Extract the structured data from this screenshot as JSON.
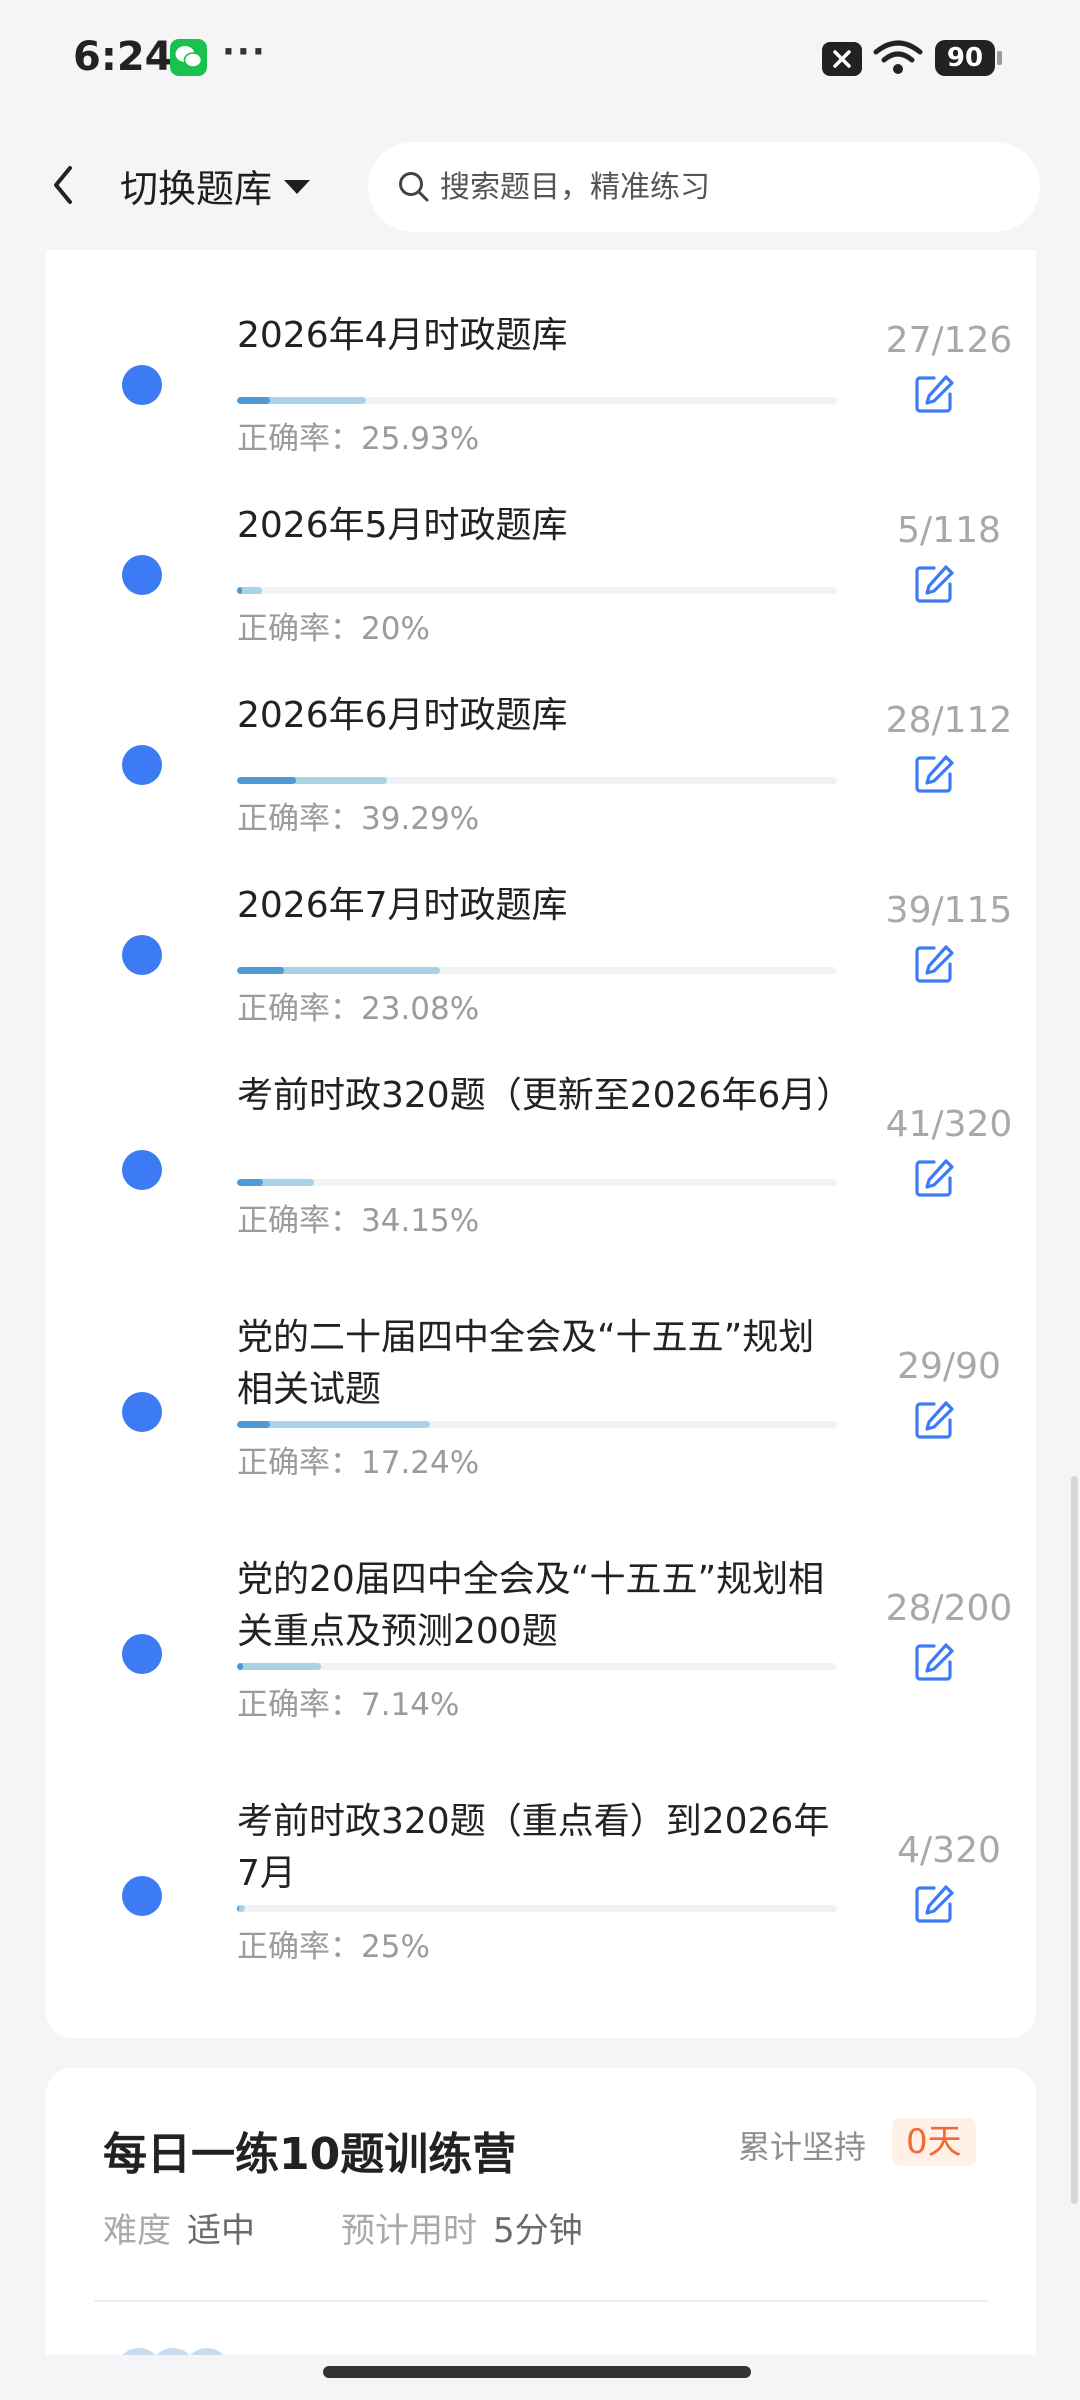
{
  "status_bar": {
    "time": "6:24",
    "more": "···",
    "battery": "90",
    "icons": [
      "wechat-icon",
      "sim-off-icon",
      "wifi-icon",
      "battery-icon"
    ]
  },
  "header": {
    "back_icon": "chevron-left-icon",
    "switch_label": "切换题库",
    "search_placeholder": "搜索题目，精准练习"
  },
  "banks": [
    {
      "title": "2026年4月时政题库",
      "accuracy": "正确率：25.93%",
      "count": "27/126",
      "done": 27,
      "total": 126,
      "rate": 25.93
    },
    {
      "title": "2026年5月时政题库",
      "accuracy": "正确率：20%",
      "count": "5/118",
      "done": 5,
      "total": 118,
      "rate": 20
    },
    {
      "title": "2026年6月时政题库",
      "accuracy": "正确率：39.29%",
      "count": "28/112",
      "done": 28,
      "total": 112,
      "rate": 39.29
    },
    {
      "title": "2026年7月时政题库",
      "accuracy": "正确率：23.08%",
      "count": "39/115",
      "done": 39,
      "total": 115,
      "rate": 23.08
    },
    {
      "title": "考前时政320题（更新至2026年6月）",
      "accuracy": "正确率：34.15%",
      "count": "41/320",
      "done": 41,
      "total": 320,
      "rate": 34.15
    },
    {
      "title": "党的二十届四中全会及“十五五”规划相关试题",
      "accuracy": "正确率：17.24%",
      "count": "29/90",
      "done": 29,
      "total": 90,
      "rate": 17.24
    },
    {
      "title": "党的20届四中全会及“十五五”规划相关重点及预测200题",
      "accuracy": "正确率：7.14%",
      "count": "28/200",
      "done": 28,
      "total": 200,
      "rate": 7.14
    },
    {
      "title": "考前时政320题（重点看）到2026年7月",
      "accuracy": "正确率：25%",
      "count": "4/320",
      "done": 4,
      "total": 320,
      "rate": 25
    }
  ],
  "daily_camp": {
    "title": "每日一练10题训练营",
    "streak_label": "累计坚持",
    "streak_value": "0天",
    "difficulty_label": "难度",
    "difficulty_value": "适中",
    "time_label": "预计用时",
    "time_value": "5分钟"
  },
  "colors": {
    "accent_blue": "#3d7bf5",
    "progress_done": "#a8d3e4",
    "progress_correct": "#4f9ad5",
    "streak_orange": "#f06b36"
  }
}
